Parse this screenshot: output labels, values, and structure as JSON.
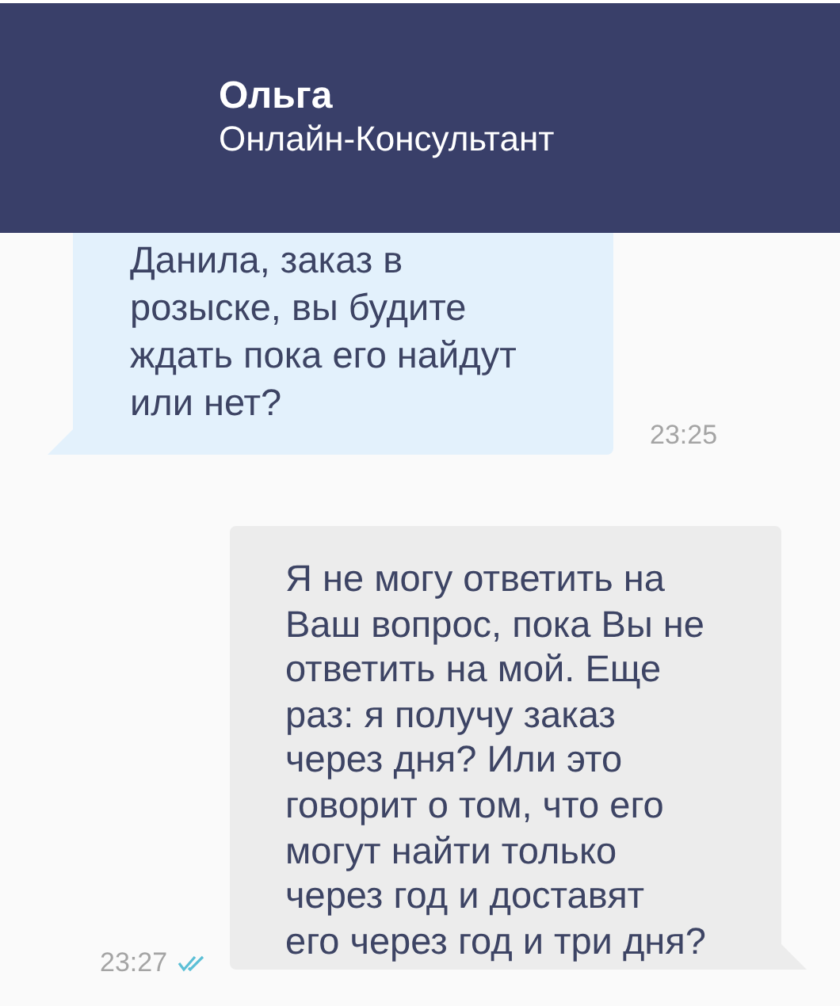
{
  "header": {
    "name": "Ольга",
    "subtitle": "Онлайн-Консультант"
  },
  "messages": [
    {
      "kind": "incoming",
      "text": "Данила, заказ в\nрозыске, вы будите\nждать пока его найдут\nили нет?",
      "time": "23:25"
    },
    {
      "kind": "outgoing",
      "text": "Я не могу ответить на\nВаш вопрос, пока Вы не\nответить на мой. Еще\nраз: я получу заказ\nчерез дня? Или это\nговорит о том, что его\nмогут найти только\nчерез год и доставят\nего через год и три дня?",
      "time": "23:27",
      "read": true
    }
  ]
}
